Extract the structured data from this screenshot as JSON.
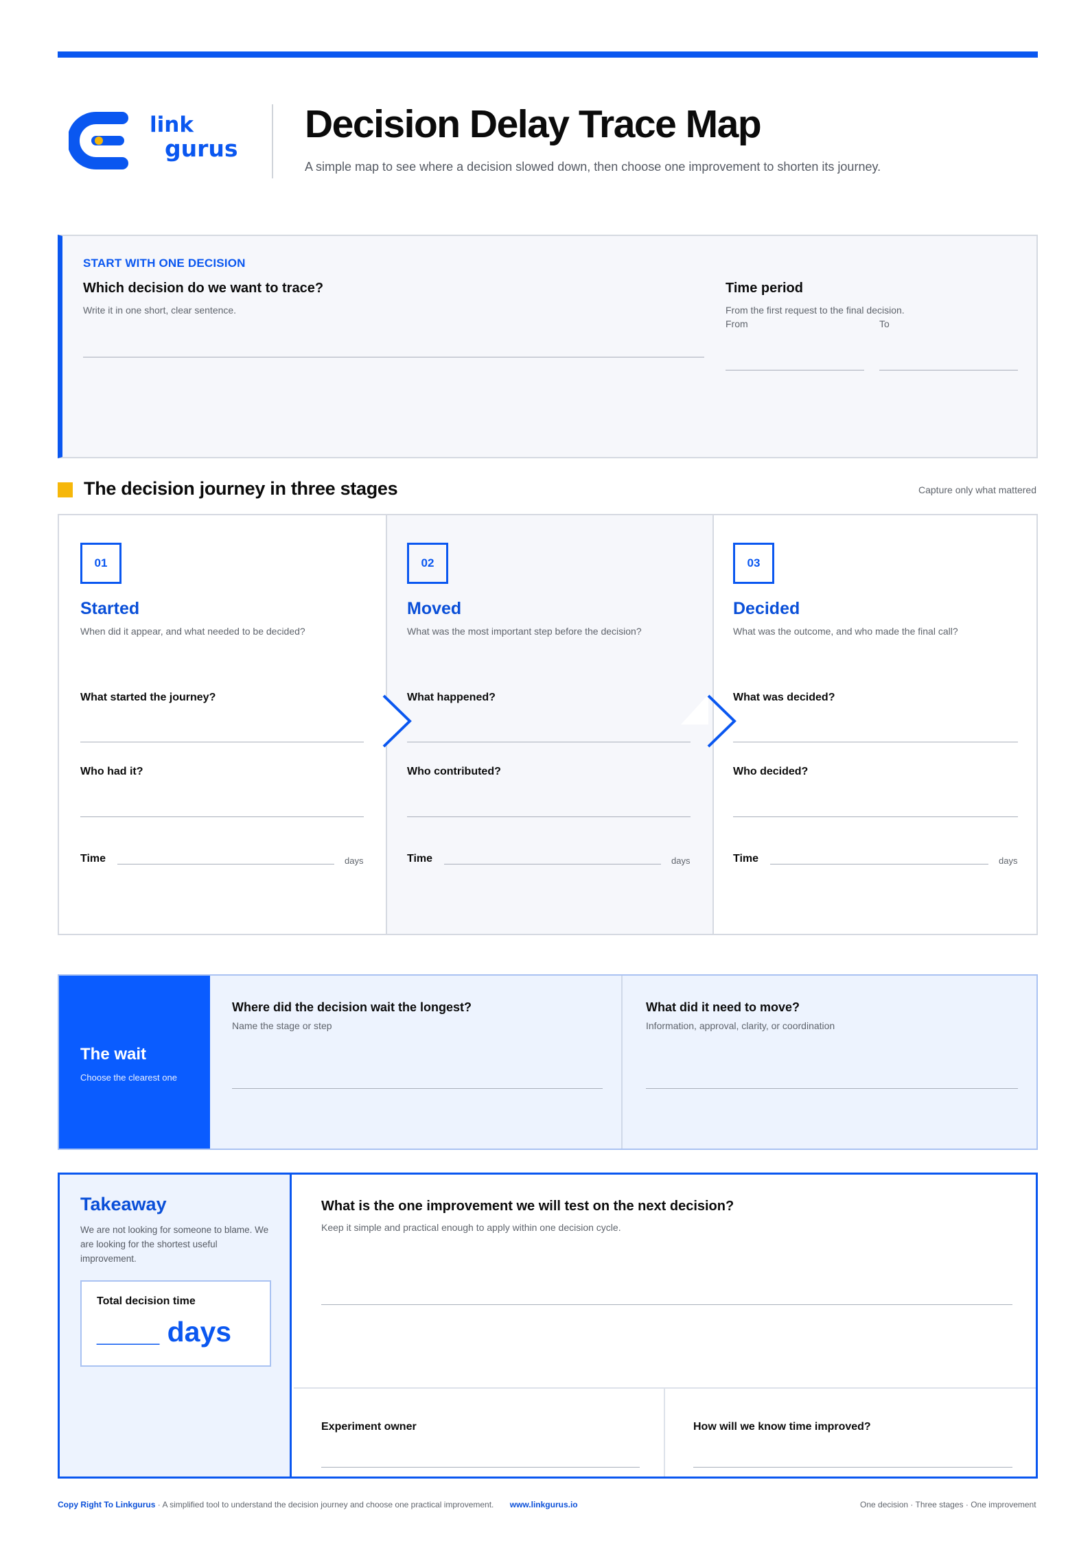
{
  "header": {
    "brand": {
      "logo_text": "linkgurus",
      "accent": "#0a57f0",
      "dot_color": "#f6b70a"
    },
    "title": "Decision Delay Trace Map",
    "subtitle": "A simple map to see where a decision slowed down, then choose one improvement to shorten its journey."
  },
  "start": {
    "kicker": "START WITH ONE DECISION",
    "question": "Which decision do we want to trace?",
    "hint": "Write it in one short, clear sentence.",
    "period": {
      "title": "Time period",
      "hint": "From the first request to the final decision.",
      "from_label": "From",
      "to_label": "To"
    }
  },
  "journey": {
    "title": "The decision journey in three stages",
    "note": "Capture only what mattered",
    "time_label": "Time",
    "time_unit": "days",
    "stages": [
      {
        "number": "01",
        "name": "Started",
        "prompt": "When did it appear, and what needed to be decided?",
        "q1": "What started the journey?",
        "q2": "Who had it?"
      },
      {
        "number": "02",
        "name": "Moved",
        "prompt": "What was the most important step before the decision?",
        "q1": "What happened?",
        "q2": "Who contributed?"
      },
      {
        "number": "03",
        "name": "Decided",
        "prompt": "What was the outcome, and who made the final call?",
        "q1": "What was decided?",
        "q2": "Who decided?"
      }
    ]
  },
  "wait": {
    "title": "The wait",
    "subtitle": "Choose the clearest one",
    "q1": "Where did the decision wait the longest?",
    "q1_hint": "Name the stage or step",
    "q2": "What did it need to move?",
    "q2_hint": "Information, approval, clarity, or coordination"
  },
  "takeaway": {
    "title": "Takeaway",
    "text": "We are not looking for someone to blame. We are looking for the shortest useful improvement.",
    "total_label": "Total decision time",
    "total_value": "____ days",
    "question": "What is the one improvement we will test on the next decision?",
    "question_hint": "Keep it simple and practical enough to apply within one decision cycle.",
    "owner_label": "Experiment owner",
    "measure_label": "How will we know time improved?"
  },
  "footer": {
    "copyright": "Copy Right To Linkgurus",
    "description": " · A simplified tool to understand the decision journey and choose one practical improvement.",
    "url": "www.linkgurus.io",
    "tagline": "One decision · Three stages · One improvement"
  }
}
